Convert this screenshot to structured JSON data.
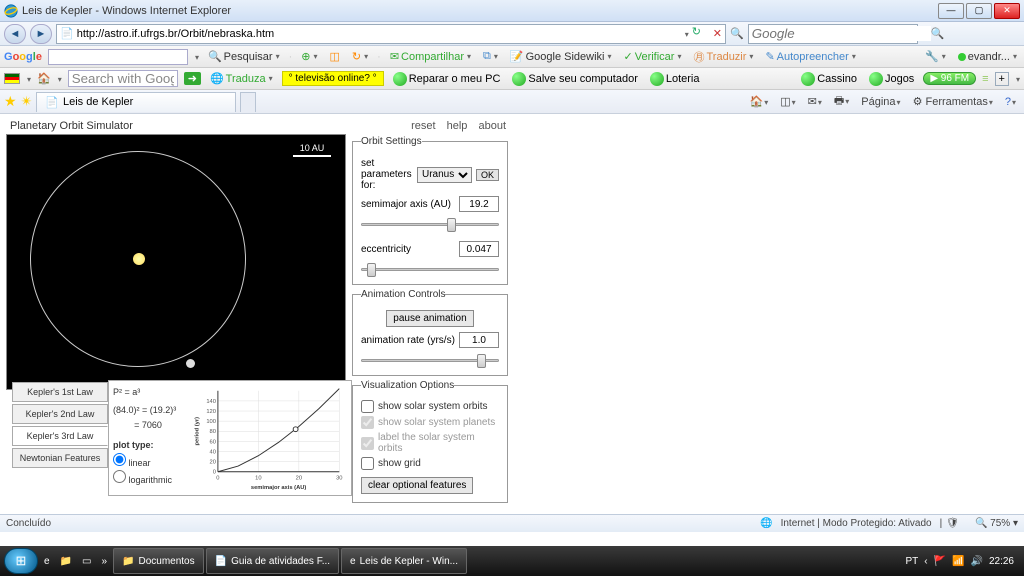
{
  "window": {
    "title": "Leis de Kepler - Windows Internet Explorer"
  },
  "nav": {
    "url": "http://astro.if.ufrgs.br/Orbit/nebraska.htm",
    "search_engine": "Google"
  },
  "google_tb": {
    "search": "Pesquisar",
    "share": "Compartilhar",
    "sidewiki": "Google Sidewiki",
    "verify": "Verificar",
    "translate": "Traduzir",
    "autofill": "Autopreencher",
    "user": "evandr..."
  },
  "tb2": {
    "search_placeholder": "Search with Google",
    "translate": "Traduza",
    "tv": "° televisão online? °",
    "repair": "Reparar o meu PC",
    "save": "Salve seu computador",
    "lottery": "Loteria",
    "casino": "Cassino",
    "games": "Jogos",
    "fm": "96 FM"
  },
  "tab": {
    "title": "Leis de Kepler",
    "page": "Página",
    "tools": "Ferramentas"
  },
  "sim": {
    "title": "Planetary Orbit Simulator",
    "links": {
      "reset": "reset",
      "help": "help",
      "about": "about"
    },
    "scale": "10 AU"
  },
  "orbit_settings": {
    "legend": "Orbit Settings",
    "param_label": "set parameters for:",
    "planet": "Uranus",
    "ok": "OK",
    "sma_label": "semimajor axis (AU)",
    "sma_value": "19.2",
    "ecc_label": "eccentricity",
    "ecc_value": "0.047"
  },
  "anim": {
    "legend": "Animation Controls",
    "pause": "pause animation",
    "rate_label": "animation rate (yrs/s)",
    "rate_value": "1.0"
  },
  "viz": {
    "legend": "Visualization Options",
    "orbits": "show solar system orbits",
    "planets": "show solar system planets",
    "labels": "label the solar system orbits",
    "grid": "show grid",
    "clear": "clear optional features"
  },
  "laws": {
    "l1": "Kepler's 1st Law",
    "l2": "Kepler's 2nd Law",
    "l3": "Kepler's 3rd Law",
    "newton": "Newtonian Features",
    "eq1": "P²  =  a³",
    "eq2": "(84.0)²  =  (19.2)³",
    "eq3": "=  7060",
    "plot_type": "plot type:",
    "linear": "linear",
    "log": "logarithmic"
  },
  "chart_data": {
    "type": "line",
    "title": "",
    "xlabel": "semimajor axis (AU)",
    "ylabel": "period (yr)",
    "xlim": [
      0,
      30
    ],
    "ylim": [
      0,
      160
    ],
    "xticks": [
      0,
      10,
      20,
      30
    ],
    "yticks": [
      0,
      20,
      40,
      60,
      80,
      100,
      120,
      140
    ],
    "x": [
      0,
      5,
      10,
      15,
      20,
      25,
      30
    ],
    "y": [
      0,
      11.2,
      31.6,
      58.1,
      89.4,
      125,
      164.3
    ],
    "marker": {
      "x": 19.2,
      "y": 84.0
    }
  },
  "status": {
    "done": "Concluído",
    "zone": "Internet | Modo Protegido: Ativado",
    "zoom": "75%"
  },
  "taskbar": {
    "docs": "Documentos",
    "guide": "Guia de atividades F...",
    "kepler": "Leis de Kepler - Win...",
    "lang": "PT",
    "time": "22:26"
  }
}
